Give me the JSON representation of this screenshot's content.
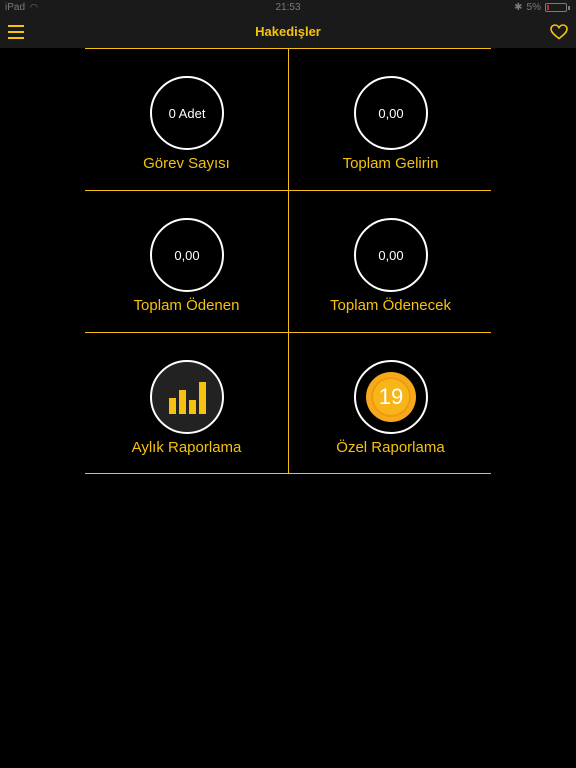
{
  "status_bar": {
    "carrier": "iPad",
    "time": "21:53",
    "battery_percent": "5%"
  },
  "nav": {
    "title": "Hakedişler",
    "menu_icon": "hamburger-icon",
    "favorite_icon": "heart-icon"
  },
  "colors": {
    "accent": "#f5c20f",
    "background": "#000000",
    "bar": "#1a1a1a"
  },
  "tiles": [
    {
      "value": "0 Adet",
      "label": "Görev Sayısı"
    },
    {
      "value": "0,00",
      "label": "Toplam Gelirin"
    },
    {
      "value": "0,00",
      "label": "Toplam Ödenen"
    },
    {
      "value": "0,00",
      "label": "Toplam Ödenecek"
    },
    {
      "icon": "bar-chart-icon",
      "label": "Aylık Raporlama"
    },
    {
      "icon": "calendar-icon",
      "value": "19",
      "label": "Özel Raporlama"
    }
  ]
}
